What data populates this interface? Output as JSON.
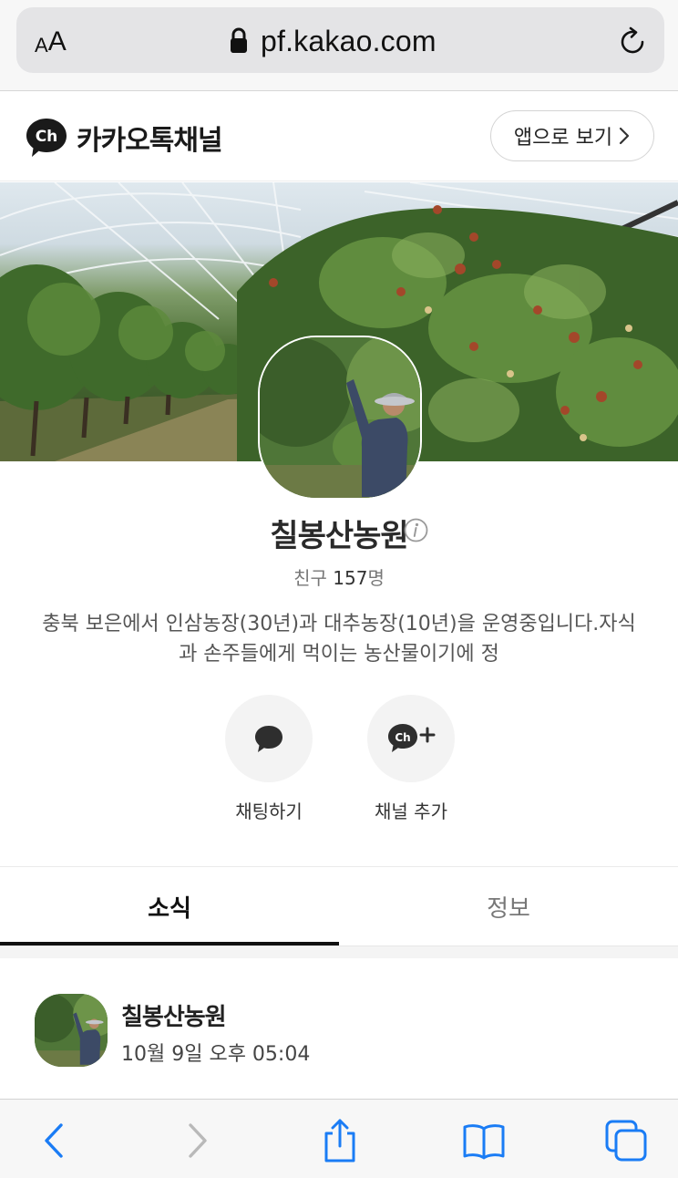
{
  "browser": {
    "text_size_label_small": "A",
    "text_size_label_big": "A",
    "url": "pf.kakao.com",
    "colors": {
      "accent": "#1a7cf5",
      "disabled": "#b9b9b9"
    },
    "toolbar_icons": [
      "back-icon",
      "forward-icon",
      "share-icon",
      "bookmarks-icon",
      "tabs-icon"
    ]
  },
  "header": {
    "logo_text": "Ch",
    "brand": "카카오톡채널",
    "open_app_label": "앱으로 보기"
  },
  "profile": {
    "name": "칠봉산농원",
    "friends_label": "친구",
    "friends_count": "157",
    "friends_unit": "명",
    "description": "충북 보은에서 인삼농장(30년)과 대추농장(10년)을 운영중입니다.자식과 손주들에게 먹이는 농산물이기에 정"
  },
  "actions": [
    {
      "label": "채팅하기",
      "icon": "chat-bubble-icon"
    },
    {
      "label": "채널 추가",
      "icon": "channel-add-icon",
      "icon_text": "Ch"
    }
  ],
  "tabs": [
    {
      "label": "소식",
      "active": true
    },
    {
      "label": "정보",
      "active": false
    }
  ],
  "post": {
    "author": "칠봉산농원",
    "time": "10월 9일 오후 05:04"
  }
}
